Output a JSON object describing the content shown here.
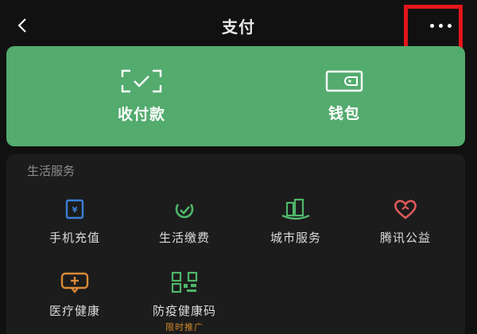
{
  "header": {
    "title": "支付",
    "back_icon": "chevron-left-icon",
    "more_icon": "more-dots-icon",
    "highlight_color": "#e3161b"
  },
  "green_card": {
    "color": "#53ab6e",
    "items": [
      {
        "label": "收付款",
        "icon": "scan-pay-icon"
      },
      {
        "label": "钱包",
        "icon": "wallet-icon"
      }
    ]
  },
  "services": {
    "title": "生活服务",
    "items": [
      {
        "label": "手机充值",
        "icon": "phone-topup-icon",
        "color": "#3c7fd6"
      },
      {
        "label": "生活缴费",
        "icon": "utility-payment-icon",
        "color": "#4fb66a"
      },
      {
        "label": "城市服务",
        "icon": "city-service-icon",
        "color": "#4fb66a"
      },
      {
        "label": "腾讯公益",
        "icon": "charity-heart-icon",
        "color": "#e05a5a"
      },
      {
        "label": "医疗健康",
        "icon": "medical-health-icon",
        "color": "#d98a38"
      },
      {
        "label": "防疫健康码",
        "icon": "health-code-icon",
        "color": "#4fb66a",
        "badge": "限时推广"
      }
    ]
  }
}
